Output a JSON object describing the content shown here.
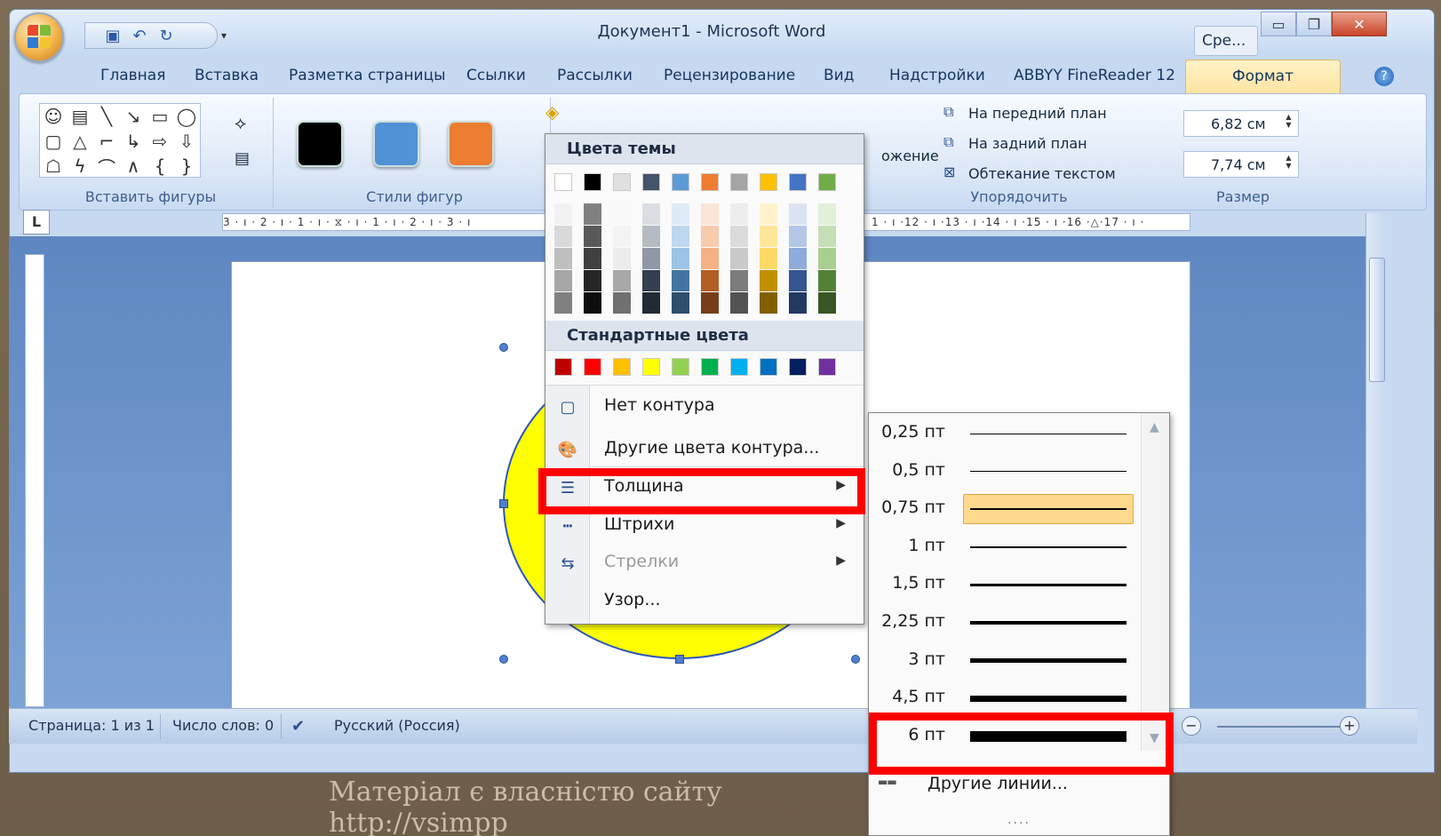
{
  "app": {
    "title": "Документ1 - Microsoft Word",
    "qat_more": "▾",
    "cre_button": "Сре..."
  },
  "tabs": [
    "Главная",
    "Вставка",
    "Разметка страницы",
    "Ссылки",
    "Рассылки",
    "Рецензирование",
    "Вид",
    "Надстройки",
    "ABBYY FineReader 12",
    "Формат"
  ],
  "ribbon": {
    "insert_shapes_label": "Вставить фигуры",
    "shape_styles_label": "Стили фигур",
    "arrange_label": "Упорядочить",
    "size_label": "Размер",
    "position_partial": "ожение",
    "bring_front": "На передний план",
    "send_back": "На задний план",
    "text_wrap": "Обтекание текстом",
    "height_value": "6,82 см",
    "width_value": "7,74 см",
    "style_colors": [
      "#000000",
      "#4f93d6",
      "#ed7d31"
    ]
  },
  "ruler": {
    "text": "3 · ı · 2 · ı · 1 · ı · ⧖ · ı · 1 · ı · 2 · ı · 3 · ı",
    "text_right": "1 · ı ·12 · ı ·13 · ı ·14 · ı ·15 · ı ·16 ·△·17 · ı ·",
    "corner": "L"
  },
  "color_menu": {
    "theme_title": "Цвета темы",
    "standard_title": "Стандартные цвета",
    "theme_colors": [
      "#ffffff",
      "#000000",
      "#eeece1",
      "#1f497d",
      "#4f81bd",
      "#c0504d",
      "#9bbb59",
      "#8064a2",
      "#4bacc6",
      "#f79646"
    ],
    "theme_base": [
      "#ffffff",
      "#000000",
      "#e0e0e0",
      "#44546a",
      "#5b9bd5",
      "#ed7d31",
      "#a5a5a5",
      "#ffc000",
      "#4472c4",
      "#70ad47"
    ],
    "standard_colors": [
      "#c00000",
      "#ff0000",
      "#ffc000",
      "#ffff00",
      "#92d050",
      "#00b050",
      "#00b0f0",
      "#0070c0",
      "#002060",
      "#7030a0"
    ],
    "items": [
      {
        "label": "Нет контура",
        "icon": "no-outline-icon",
        "has_submenu": false,
        "disabled": false
      },
      {
        "label": "Другие цвета контура...",
        "icon": "palette-icon",
        "has_submenu": false,
        "disabled": false
      },
      {
        "label": "Толщина",
        "icon": "line-weight-icon",
        "has_submenu": true,
        "disabled": false
      },
      {
        "label": "Штрихи",
        "icon": "dashes-icon",
        "has_submenu": true,
        "disabled": false
      },
      {
        "label": "Стрелки",
        "icon": "arrows-icon",
        "has_submenu": true,
        "disabled": true
      },
      {
        "label": "Узор...",
        "icon": "pattern-icon",
        "has_submenu": false,
        "disabled": false
      }
    ]
  },
  "weight_menu": {
    "weights": [
      "0,25 пт",
      "0,5 пт",
      "0,75 пт",
      "1 пт",
      "1,5 пт",
      "2,25 пт",
      "3 пт",
      "4,5 пт",
      "6 пт"
    ],
    "selected": "0,75 пт",
    "more_lines": "Другие линии..."
  },
  "statusbar": {
    "page": "Страница: 1 из 1",
    "words": "Число слов: 0",
    "language": "Русский (Россия)"
  },
  "watermark": "Матеріал є власністю сайту http://vsimpp"
}
